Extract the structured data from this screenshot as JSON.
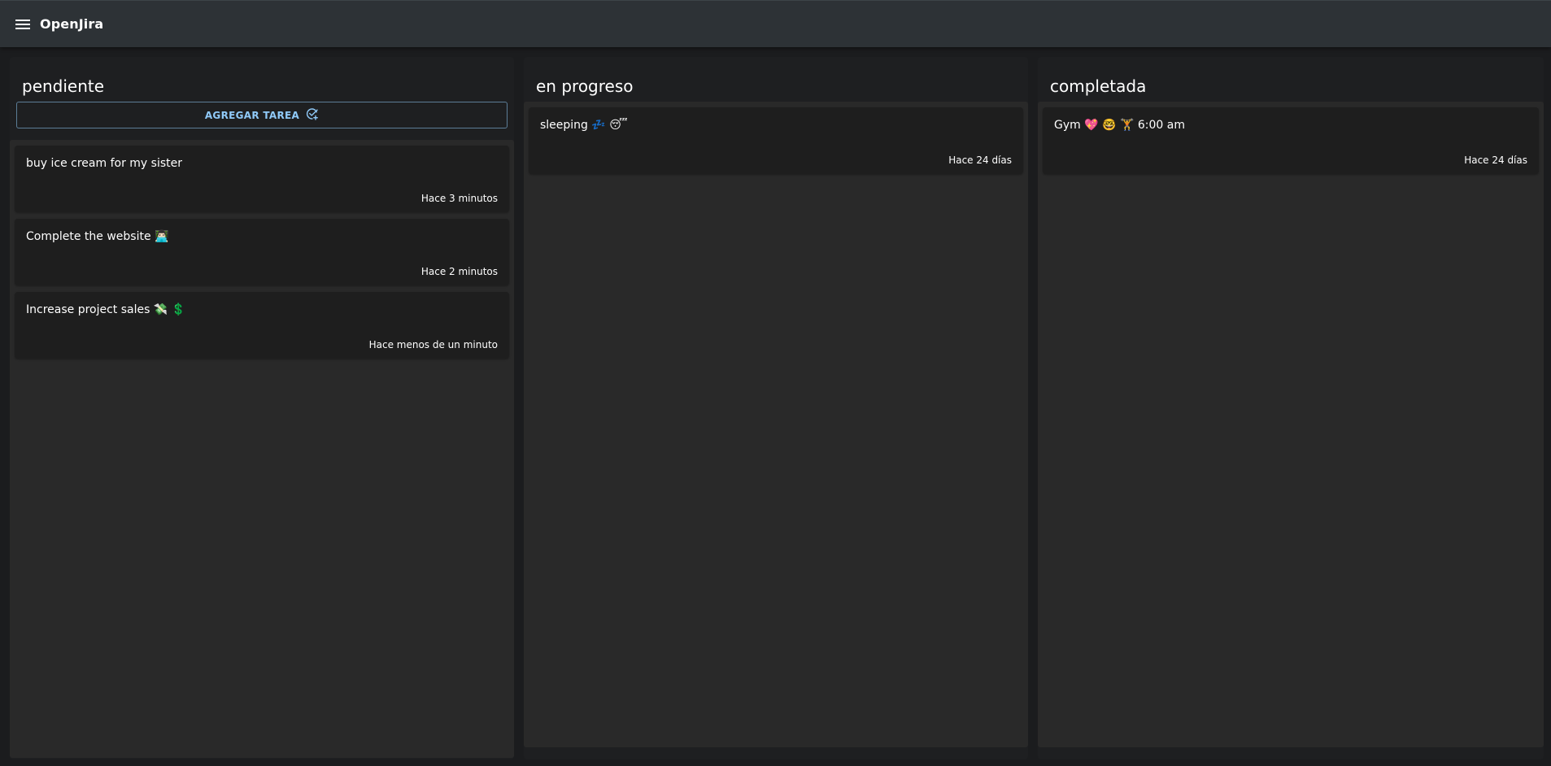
{
  "app": {
    "title": "OpenJira"
  },
  "columns": [
    {
      "title": "pendiente",
      "add_label": "AGREGAR TAREA",
      "cards": [
        {
          "description": "buy ice cream for my sister",
          "time": "Hace 3 minutos"
        },
        {
          "description": "Complete the website 👨🏻‍💻",
          "time": "Hace 2 minutos"
        },
        {
          "description": "Increase project sales 💸 💲",
          "time": "Hace menos de un minuto"
        }
      ]
    },
    {
      "title": "en progreso",
      "cards": [
        {
          "description": "sleeping 💤 😴",
          "time": "Hace 24 días"
        }
      ]
    },
    {
      "title": "completada",
      "cards": [
        {
          "description": "Gym 💖 🤓 🏋 6:00 am",
          "time": "Hace 24 días"
        }
      ]
    }
  ],
  "icons": {
    "menu": "menu-icon",
    "add_task": "add-task-check-icon"
  },
  "colors": {
    "appbar": "#2d3236",
    "background": "#1b1c1e",
    "column": "#1e1f21",
    "list": "#292929",
    "card": "#1e1e1e",
    "accent": "#90caf9"
  }
}
